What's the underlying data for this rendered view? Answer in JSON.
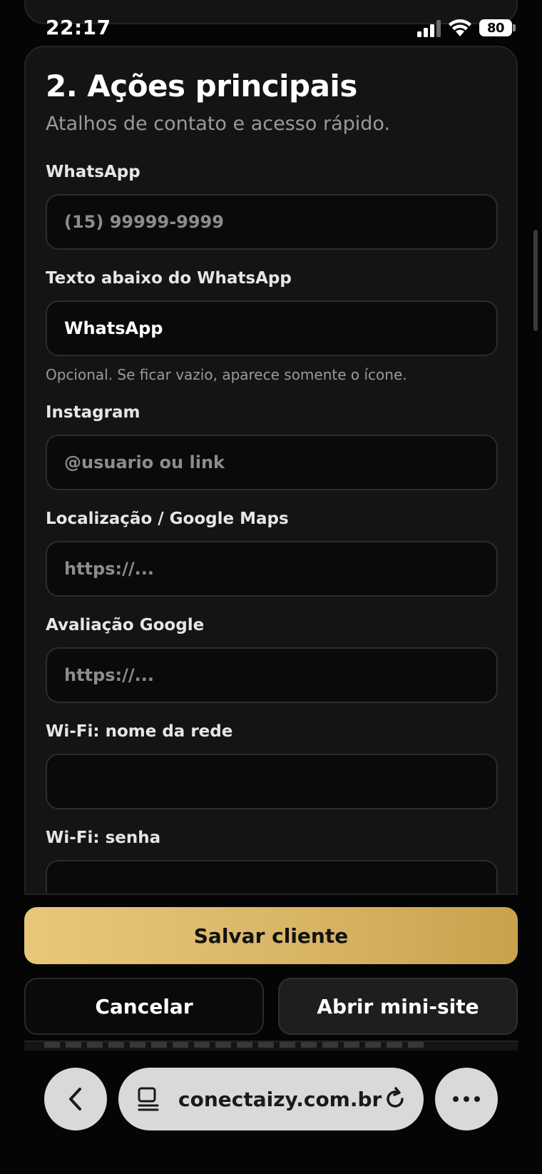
{
  "status_bar": {
    "time": "22:17",
    "battery": "80",
    "icons": [
      "signal-icon",
      "wifi-icon",
      "battery-icon"
    ]
  },
  "section": {
    "title": "2. Ações principais",
    "subtitle": "Atalhos de contato e acesso rápido."
  },
  "fields": {
    "whatsapp": {
      "label": "WhatsApp",
      "value": "",
      "placeholder": "(15) 99999-9999"
    },
    "whatsapp_text": {
      "label": "Texto abaixo do WhatsApp",
      "value": "WhatsApp",
      "placeholder": "",
      "hint": "Opcional. Se ficar vazio, aparece somente o ícone."
    },
    "instagram": {
      "label": "Instagram",
      "value": "",
      "placeholder": "@usuario ou link"
    },
    "location": {
      "label": "Localização / Google Maps",
      "value": "",
      "placeholder": "https://..."
    },
    "review": {
      "label": "Avaliação Google",
      "value": "",
      "placeholder": "https://..."
    },
    "wifi_name": {
      "label": "Wi-Fi: nome da rede",
      "value": "",
      "placeholder": ""
    },
    "wifi_password": {
      "label": "Wi-Fi: senha",
      "value": "",
      "placeholder": ""
    }
  },
  "actions": {
    "save": "Salvar cliente",
    "cancel": "Cancelar",
    "open": "Abrir mini-site"
  },
  "browser": {
    "url": "conectaizy.com.br",
    "icons": [
      "back-icon",
      "tabs-icon",
      "reload-icon",
      "more-icon"
    ]
  },
  "colors": {
    "accent_gold": "#d9b566",
    "background": "#050505",
    "card": "#141414"
  }
}
